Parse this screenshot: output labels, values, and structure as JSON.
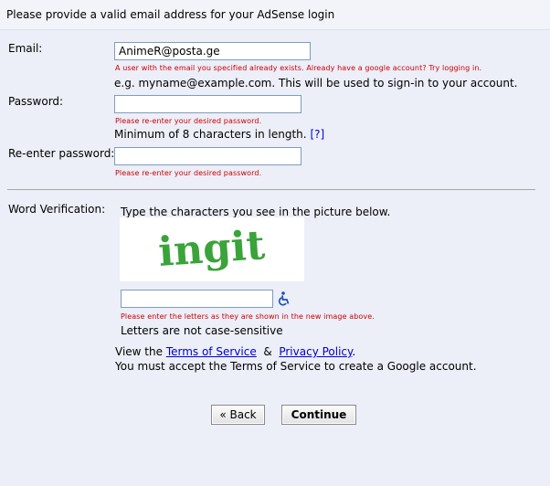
{
  "header": {
    "text": "Please provide a valid email address for your AdSense login"
  },
  "email": {
    "label": "Email:",
    "value": "AnimeR@posta.ge",
    "error": "A user with the email you specified already exists. Already have a google account? Try logging in.",
    "hint": "e.g. myname@example.com. This will be used to sign-in to your account."
  },
  "password": {
    "label": "Password:",
    "value": "",
    "error": "Please re-enter your desired password.",
    "hint": "Minimum of 8 characters in length.",
    "help_link": "[?]"
  },
  "reenter": {
    "label": "Re-enter password:",
    "value": "",
    "error": "Please re-enter your desired password."
  },
  "verification": {
    "label": "Word Verification:",
    "instruction": "Type the characters you see in the picture below.",
    "captcha_text": "ingit",
    "value": "",
    "error": "Please enter the letters as they are shown in the new image above.",
    "note": "Letters are not case-sensitive",
    "accessibility_icon": "wheelchair-icon"
  },
  "terms": {
    "prefix": "View the",
    "tos_link": "Terms of Service",
    "amp": "&",
    "privacy_link": "Privacy Policy",
    "period": ".",
    "notice": "You must accept the Terms of Service to create a Google account."
  },
  "buttons": {
    "back": "« Back",
    "continue": "Continue"
  },
  "colors": {
    "error": "#cc0000",
    "link": "#0000cc",
    "captcha": "#3aa33a",
    "background": "#eceef8"
  }
}
